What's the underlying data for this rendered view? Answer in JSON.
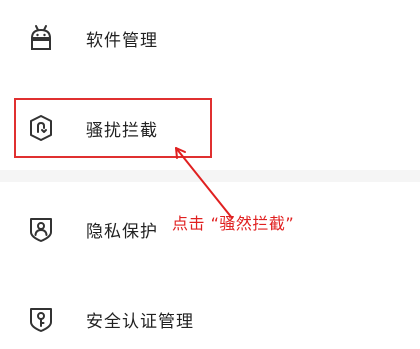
{
  "menu": {
    "items": [
      {
        "label": "软件管理",
        "icon": "android-icon"
      },
      {
        "label": "骚扰拦截",
        "icon": "shield-block-icon"
      },
      {
        "label": "隐私保护",
        "icon": "shield-person-icon"
      },
      {
        "label": "安全认证管理",
        "icon": "shield-key-icon"
      }
    ]
  },
  "annotation": {
    "text": "点击 “骚然拦截”",
    "color": "#e02020"
  },
  "colors": {
    "icon": "#333333",
    "highlight": "#e03030"
  }
}
